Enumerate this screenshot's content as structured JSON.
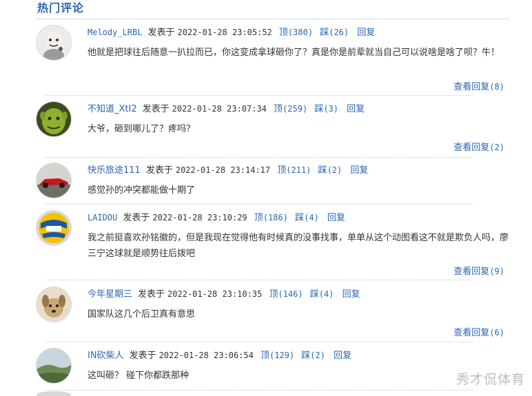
{
  "section": {
    "title": "热门评论"
  },
  "labels": {
    "posted_prefix": "发表于",
    "up": "顶",
    "down": "踩",
    "reply": "回复",
    "view_replies": "查看回复"
  },
  "comments": [
    {
      "user": "Melody_LRBL",
      "time": "2022-01-28 23:05:52",
      "up": "(380)",
      "down": "(26)",
      "text": "他就是把球往后随意一扒拉而已，你这变成拿球砸你了？真是你是前辈就当自己可以说啥是啥了呗？牛！",
      "replies": "(8)",
      "avatar_icon": "cartoon-figure-avatar"
    },
    {
      "user": "不知道_XtI2",
      "time": "2022-01-28 23:07:34",
      "up": "(259)",
      "down": "(3)",
      "text": "大爷，砸到哪儿了？疼吗？",
      "replies": "(2)",
      "avatar_icon": "green-ogre-avatar"
    },
    {
      "user": "快乐旅途111",
      "time": "2022-01-28 23:14:17",
      "up": "(211)",
      "down": "(2)",
      "text": "感觉孙的冲突都能做十期了",
      "replies": "",
      "avatar_icon": "red-race-car-avatar"
    },
    {
      "user": "LAIDOU",
      "time": "2022-01-28 23:10:29",
      "up": "(186)",
      "down": "(4)",
      "text": "我之前挺喜欢孙铭徽的，但是我现在觉得他有时候真的没事找事，单单从这个动图看这不就是欺负人吗，廖三宁这球就是顺势往后拨吧",
      "replies": "(9)",
      "avatar_icon": "volleyball-avatar"
    },
    {
      "user": "今年星期三",
      "time": "2022-01-28 23:10:35",
      "up": "(146)",
      "down": "(4)",
      "text": "国家队这几个后卫真有意思",
      "replies": "(6)",
      "avatar_icon": "dog-avatar"
    },
    {
      "user": "IN砍柴人",
      "time": "2022-01-28 23:06:54",
      "up": "(129)",
      "down": "(2)",
      "text": "这叫砸？ 碰下你都跌那种",
      "replies": "",
      "avatar_icon": "landscape-avatar"
    }
  ],
  "watermark": "秀才侃体育"
}
